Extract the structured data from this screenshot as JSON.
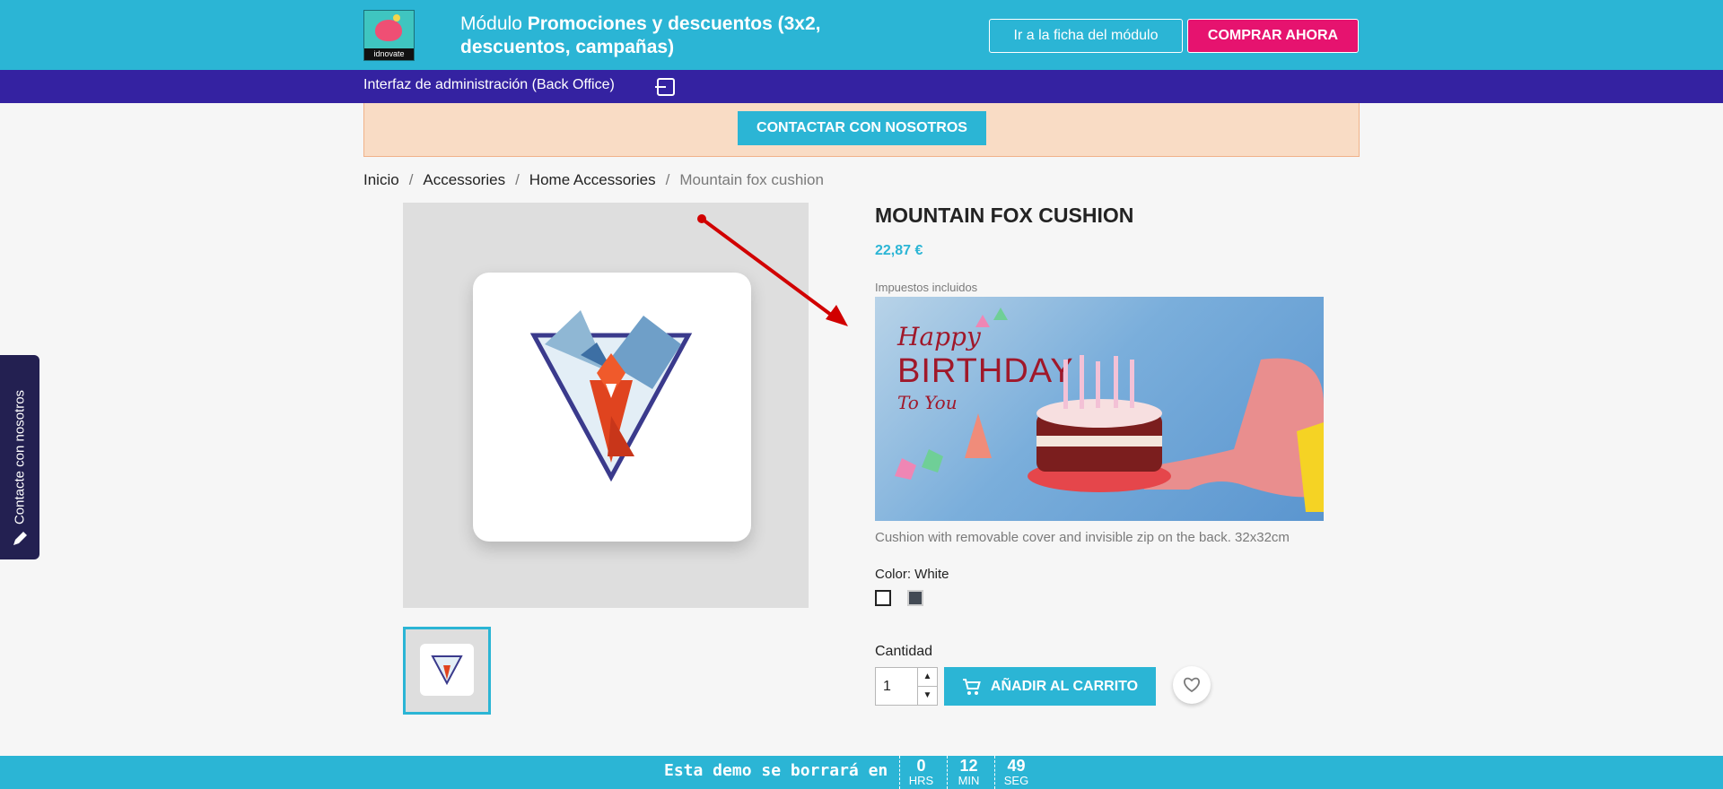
{
  "header": {
    "logo_text": "idnovate",
    "title_prefix": "Módulo ",
    "title_bold": "Promociones y descuentos (3x2, descuentos, campañas)",
    "module_page_button": "Ir a la ficha del módulo",
    "buy_button": "COMPRAR AHORA"
  },
  "admin_bar": {
    "label": "Interfaz de administración (Back Office)"
  },
  "banner": {
    "contact_button": "CONTACTAR CON NOSOTROS"
  },
  "breadcrumb": [
    "Inicio",
    "Accessories",
    "Home Accessories",
    "Mountain fox cushion"
  ],
  "product": {
    "name": "MOUNTAIN FOX CUSHION",
    "price": "22,87 €",
    "tax_note": "Impuestos incluidos",
    "description": "Cushion with removable cover and invisible zip on the back. 32x32cm",
    "color_label": "Color: White",
    "colors": [
      "#ffffff",
      "#434a54"
    ],
    "quantity_label": "Cantidad",
    "quantity_value": "1",
    "add_to_cart": "AÑADIR AL CARRITO"
  },
  "promo_image": {
    "line1": "Happy",
    "line2": "BIRTHDAY",
    "line3": "To You"
  },
  "side_tab": {
    "label": "Contacte con nosotros"
  },
  "footer": {
    "message": "Esta demo se borrará en",
    "hours": "0",
    "hours_unit": "HRS",
    "minutes": "12",
    "minutes_unit": "MIN",
    "seconds": "49",
    "seconds_unit": "SEG"
  }
}
